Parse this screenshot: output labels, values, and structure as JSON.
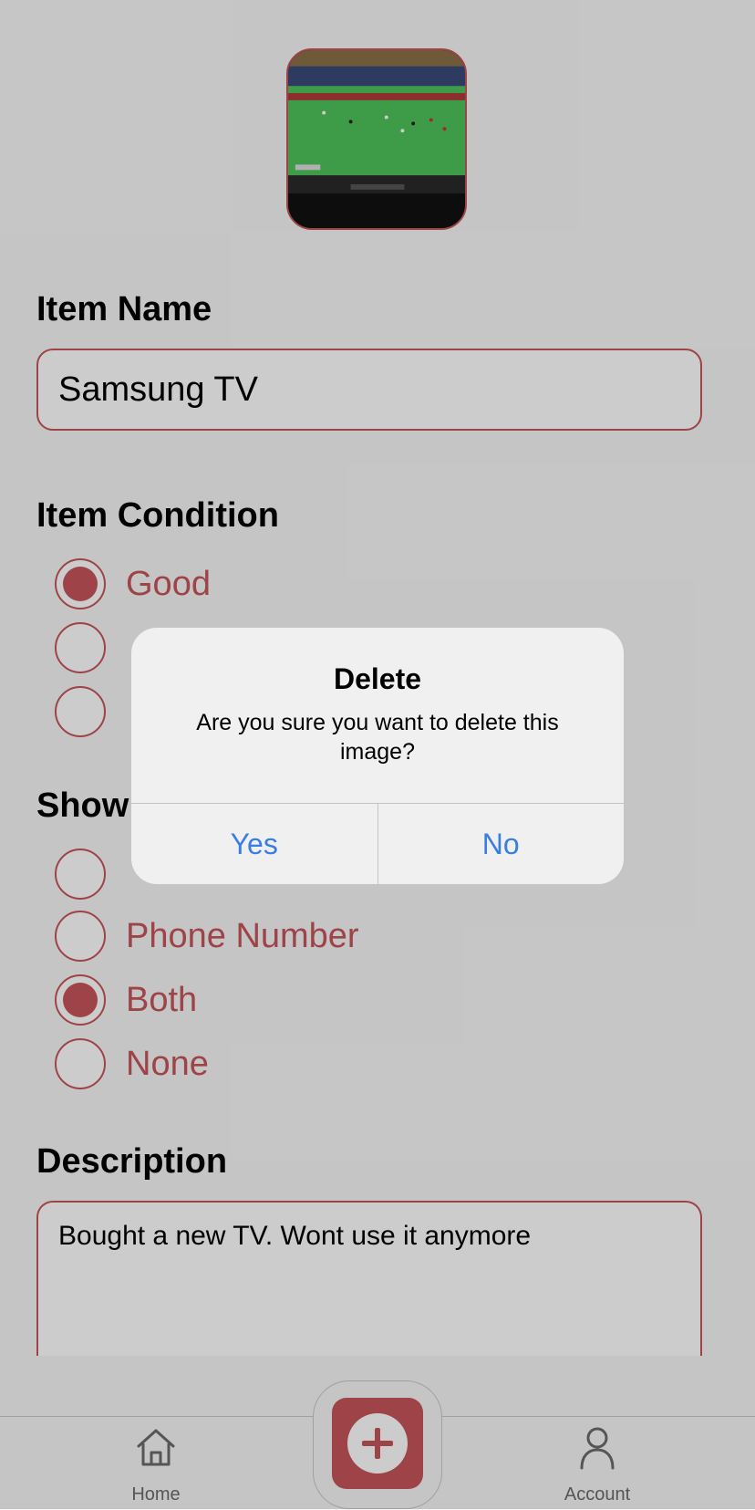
{
  "form": {
    "image": {
      "icon": "tv-photo-thumbnail"
    },
    "item_name": {
      "label": "Item Name",
      "value": "Samsung TV"
    },
    "item_condition": {
      "label": "Item Condition",
      "options": [
        {
          "label": "Good",
          "selected": true
        },
        {
          "label": "",
          "selected": false
        },
        {
          "label": "",
          "selected": false
        }
      ]
    },
    "show": {
      "label": "Show",
      "options": [
        {
          "label": "",
          "selected": false
        },
        {
          "label": "Phone Number",
          "selected": false
        },
        {
          "label": "Both",
          "selected": true
        },
        {
          "label": "None",
          "selected": false
        }
      ]
    },
    "description": {
      "label": "Description",
      "value": "Bought a new TV. Wont use it anymore"
    }
  },
  "tabbar": {
    "home_label": "Home",
    "home_icon": "home-icon",
    "add_icon": "plus-icon",
    "account_label": "Account",
    "account_icon": "person-icon"
  },
  "alert": {
    "title": "Delete",
    "message": "Are you sure you want to delete this image?",
    "yes_label": "Yes",
    "no_label": "No"
  },
  "colors": {
    "accent": "#c6545a",
    "alert_button": "#3a7ee4",
    "background": "#f7f7f7"
  }
}
